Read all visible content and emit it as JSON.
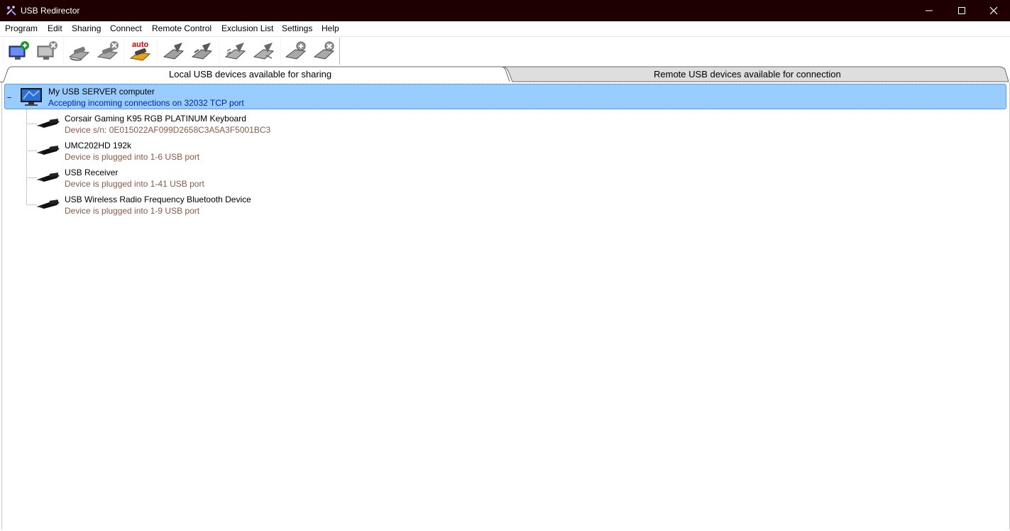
{
  "window": {
    "title": "USB Redirector"
  },
  "menu": [
    "Program",
    "Edit",
    "Sharing",
    "Connect",
    "Remote Control",
    "Exclusion List",
    "Settings",
    "Help"
  ],
  "toolbar": {
    "auto_label": "auto",
    "buttons": [
      "add-server-icon",
      "remove-server-icon",
      "share-device-icon",
      "unshare-device-icon",
      "auto-share-icon",
      "connect-device-icon",
      "disconnect-device-icon",
      "connect-all-icon",
      "disconnect-all-icon",
      "add-remote-icon",
      "remove-remote-icon"
    ]
  },
  "tabs": {
    "local": "Local USB devices available for sharing",
    "remote": "Remote USB devices available for connection"
  },
  "server": {
    "name": "My USB SERVER computer",
    "status": "Accepting incoming connections on 32032 TCP port",
    "collapse_symbol": "−"
  },
  "devices": [
    {
      "name": "Corsair Gaming K95 RGB PLATINUM Keyboard",
      "info": "Device s/n: 0E015022AF099D2658C3A5A3F5001BC3"
    },
    {
      "name": "UMC202HD 192k",
      "info": "Device is plugged into 1-6 USB port"
    },
    {
      "name": "USB Receiver",
      "info": "Device is plugged into 1-41 USB port"
    },
    {
      "name": "USB Wireless Radio Frequency Bluetooth Device",
      "info": "Device is plugged into 1-9 USB port"
    }
  ],
  "colors": {
    "titlebar": "#1f0000",
    "selection": "#99ccff",
    "status_text": "#0a24a8",
    "device_info": "#8b5a44"
  }
}
